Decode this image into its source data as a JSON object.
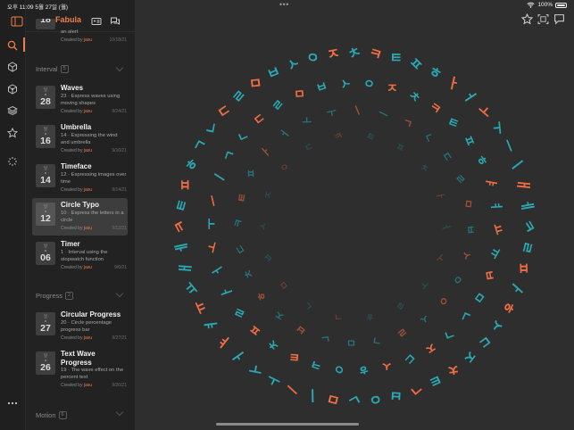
{
  "status_bar": {
    "time": "오후 11:09",
    "date": "5월 27일 (월)",
    "battery": "100%",
    "dots": "•••"
  },
  "rail": {
    "icons": [
      "search-icon",
      "cube-outline-icon",
      "cube-icon",
      "layers-icon",
      "star-icon",
      "loader-icon",
      "more-icon"
    ]
  },
  "sidebar": {
    "app_title": "Fabula",
    "partial_item": {
      "day": "일",
      "num": "18",
      "desc": "an alert",
      "created_by": "Created by",
      "author": "jasu",
      "date": "10/18/21"
    },
    "sections": [
      {
        "name": "Interval",
        "count": "5",
        "items": [
          {
            "day": "일",
            "num": "28",
            "title": "Waves",
            "desc": "23 · Express waves using moving shapes",
            "created_by": "Created by",
            "author": "jasu",
            "date": "9/24/21"
          },
          {
            "day": "일",
            "num": "16",
            "title": "Umbrella",
            "desc": "14 · Expressing the wind and umbrella",
            "created_by": "Created by",
            "author": "jasu",
            "date": "9/16/21"
          },
          {
            "day": "일",
            "num": "14",
            "title": "Timeface",
            "desc": "12 · Expressing images over time",
            "created_by": "Created by",
            "author": "jasu",
            "date": "9/14/21"
          },
          {
            "day": "일",
            "num": "12",
            "title": "Circle Typo",
            "desc": "10 · Express the letters in a circle",
            "created_by": "Created by",
            "author": "jasu",
            "date": "9/12/21"
          },
          {
            "day": "일",
            "num": "06",
            "title": "Timer",
            "desc": "1 · Interval using the stopwatch function",
            "created_by": "Created by",
            "author": "jasu",
            "date": "9/6/21"
          }
        ]
      },
      {
        "name": "Progress",
        "count": "2",
        "items": [
          {
            "day": "일",
            "num": "27",
            "title": "Circular Progress",
            "desc": "20 · Circle percentage progress bar",
            "created_by": "Created by",
            "author": "jasu",
            "date": "9/27/21"
          },
          {
            "day": "일",
            "num": "26",
            "title": "Text Wave Progress",
            "desc": "19 · The wave effect on the percent text",
            "created_by": "Created by",
            "author": "jasu",
            "date": "9/26/21"
          }
        ]
      },
      {
        "name": "Motion",
        "count": "6",
        "items": []
      }
    ]
  },
  "canvas": {
    "colors": {
      "orange": "#ef6d42",
      "teal": "#2aa7b0",
      "orange_dim": "#9b5038",
      "teal_dim": "#267178",
      "orange_faint": "#6a3f31",
      "teal_faint": "#2a4d52"
    },
    "rings": [
      {
        "glyphs": "ㅋㄹㅍㅏㅎㅅㄷㅈㅊㅌㄱㅂㅇㄴㅁㅣㅡㅗㅜㅓㅑㅕㅠㅛㅐㅔㅋㅌㅍㅎㄱㄴㄷㄹㅁㅂㅅㅇㅈㅊㅋㅌㅍㅎㅏㅓㅗㅜㅡㅣㅐㅔ",
        "tone": "bright"
      },
      {
        "glyphs": "ㅂㅁㄴㄱㅈㄷㅅㅎㅇㅋㅌㅊㅍㄹㅏㅓㅗㅜㅡㅣㄱㄴㄷㄹㅁㅂㅅㅇㅈㅊㅋㅌㅍㅎㅑㅕㅛㅠ",
        "tone": "bright"
      },
      {
        "glyphs": "ㅇㅅㄹㄱㅁㄴㅂㅈㅎㅊㄷㅋㅌㅍㅏㅓㅗㅜㅣㅡㄱㄴㄷㄹㅁㅂㅅㅇ",
        "tone": "dim"
      },
      {
        "glyphs": "ㄹㅎㄱㄴㅁㅂㅅㅈㅇㄷㅋㅌㅍㅊㅏㅓㅗㅜ",
        "tone": "faint"
      }
    ]
  }
}
